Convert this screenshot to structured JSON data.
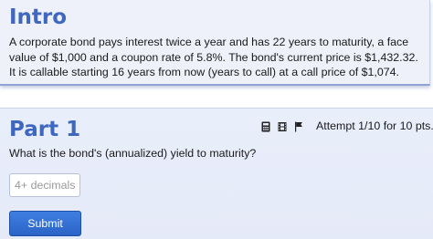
{
  "intro": {
    "title": "Intro",
    "text": "A corporate bond pays interest twice a year and has 22 years to maturity, a face value of $1,000 and a coupon rate of 5.8%. The bond's current price is $1,432.32. It is callable starting 16 years from now (years to call) at a call price of $1,074."
  },
  "part": {
    "title": "Part 1",
    "attempt": "Attempt 1/10 for 10 pts.",
    "question": "What is the bond's (annualized) yield to maturity?",
    "icons": [
      "calculator-icon",
      "film-icon",
      "flag-icon"
    ]
  },
  "answer": {
    "placeholder": "4+ decimals",
    "value": ""
  },
  "submit": {
    "label": "Submit"
  },
  "colors": {
    "title": "#3f67c0",
    "card_background": "#eef1fa",
    "button": "#2c63c7"
  }
}
